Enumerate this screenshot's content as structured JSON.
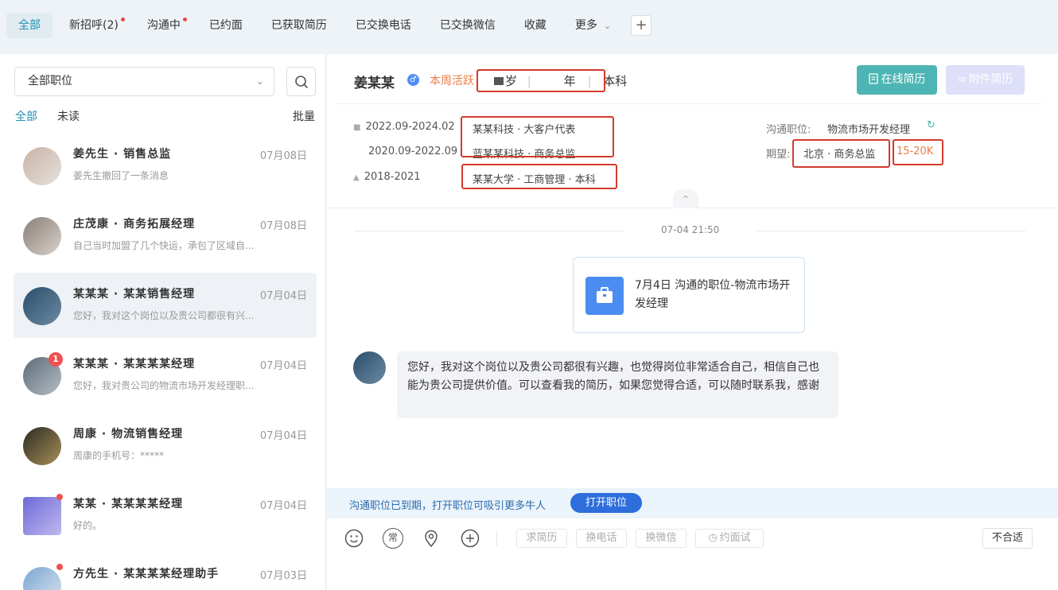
{
  "tabs": [
    {
      "label": "全部",
      "active": true,
      "dot": false
    },
    {
      "label": "新招呼(2)",
      "active": false,
      "dot": true
    },
    {
      "label": "沟通中",
      "active": false,
      "dot": true
    },
    {
      "label": "已约面",
      "active": false,
      "dot": false
    },
    {
      "label": "已获取简历",
      "active": false,
      "dot": false
    },
    {
      "label": "已交换电话",
      "active": false,
      "dot": false
    },
    {
      "label": "已交换微信",
      "active": false,
      "dot": false
    },
    {
      "label": "收藏",
      "active": false,
      "dot": false
    },
    {
      "label": "更多",
      "active": false,
      "dot": false,
      "dropdown": true
    }
  ],
  "add_tab_label": "+",
  "sidebar": {
    "position_select": "全部职位",
    "filters": {
      "all": "全部",
      "unread": "未读",
      "batch": "批量"
    },
    "conversations": [
      {
        "name": "姜先生 · 销售总监",
        "date": "07月08日",
        "preview": "姜先生撤回了一条消息"
      },
      {
        "name": "庄茂康 · 商务拓展经理",
        "date": "07月08日",
        "preview": "自己当时加盟了几个快运，承包了区域自..."
      },
      {
        "name": "某某某 · 某某销售经理",
        "date": "07月04日",
        "preview": "您好，我对这个岗位以及贵公司都很有兴..."
      },
      {
        "name": "某某某 · 某某某某经理",
        "date": "07月04日",
        "preview": "您好，我对贵公司的物流市场开发经理职...",
        "badge": "1"
      },
      {
        "name": "周康 · 物流销售经理",
        "date": "07月04日",
        "preview": "周康的手机号：*****"
      },
      {
        "name": "某某 · 某某某某经理",
        "date": "07月04日",
        "preview": "好的。"
      },
      {
        "name": "方先生 · 某某某某经理助手",
        "date": "07月03日",
        "preview": ""
      }
    ]
  },
  "profile": {
    "name": "姜某某",
    "active_status": "本周活跃",
    "age": "岁",
    "years": "年",
    "degree": "本科",
    "btn_online_resume": "在线简历",
    "btn_attachment_resume": "附件简历",
    "work": [
      {
        "period": "2022.09-2024.02",
        "desc": "某某科技 · 大客户代表"
      },
      {
        "period": "2020.09-2022.09",
        "desc": "蓝某某科技 · 商务总监"
      }
    ],
    "education": {
      "period": "2018-2021",
      "desc": "某某大学 · 工商管理 · 本科"
    },
    "job_label": "沟通职位:",
    "job_value": "物流市场开发经理",
    "expect_label": "期望:",
    "expect_value": "北京 · 商务总监",
    "salary": "15-20K"
  },
  "chat": {
    "timestamp": "07-04 21:50",
    "job_card_text": "7月4日 沟通的职位-物流市场开发经理",
    "message": "您好，我对这个岗位以及贵公司都很有兴趣，也觉得岗位非常适合自己，相信自己也能为贵公司提供价值。可以查看我的简历，如果您觉得合适，可以随时联系我，感谢"
  },
  "notice": {
    "text": "沟通职位已到期，打开职位可吸引更多牛人",
    "button": "打开职位"
  },
  "toolbar": {
    "common_label": "常",
    "request_resume": "求简历",
    "exchange_phone": "换电话",
    "exchange_wechat": "换微信",
    "interview": "约面试",
    "not_fit": "不合适"
  },
  "colors": {
    "accent": "#1f8fb5",
    "resume_button": "#4db5b3",
    "salary": "#ec7c44",
    "highlight_box": "#d33a2c",
    "notice_button": "#2d6edc"
  }
}
